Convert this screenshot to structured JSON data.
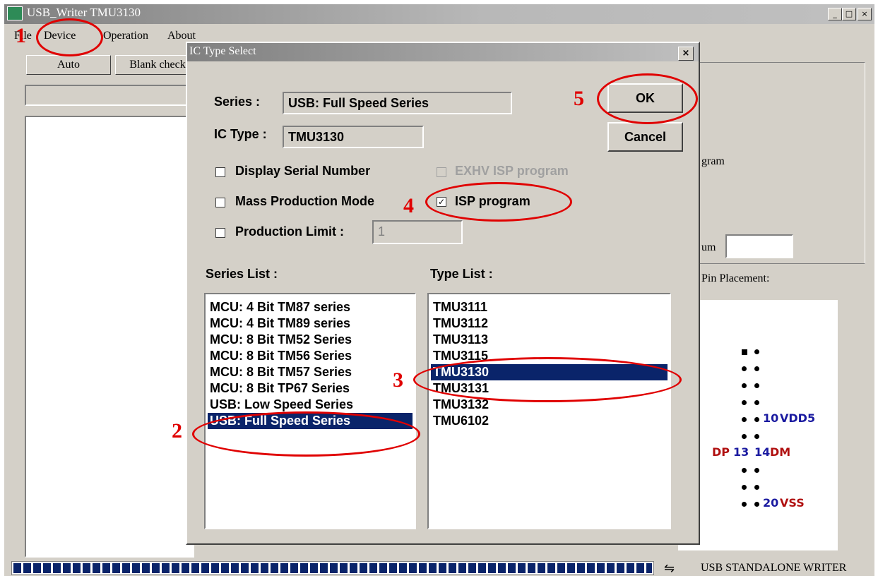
{
  "window": {
    "title": "USB_Writer  TMU3130",
    "minimize_glyph": "_",
    "maximize_glyph": "□",
    "close_glyph": "×"
  },
  "menu": {
    "file": "File",
    "device": "Device",
    "operation": "Operation",
    "about": "About"
  },
  "toolbar": {
    "auto": "Auto",
    "blank_check": "Blank check"
  },
  "background_panel": {
    "program_fragment": "gram",
    "sum_fragment": "um",
    "pin_placement": "Pin Placement:"
  },
  "pin_diagram": {
    "rows": [
      {
        "left": "",
        "left_num": "",
        "right_num": "",
        "right": "",
        "first_square": true
      },
      {
        "left": "",
        "left_num": "",
        "right_num": "",
        "right": ""
      },
      {
        "left": "",
        "left_num": "",
        "right_num": "",
        "right": ""
      },
      {
        "left": "",
        "left_num": "",
        "right_num": "",
        "right": ""
      },
      {
        "left": "",
        "left_num": "",
        "right_num": "10",
        "right": "VDD5"
      },
      {
        "left": "",
        "left_num": "",
        "right_num": "",
        "right": ""
      },
      {
        "left": "DP",
        "left_num": "13",
        "right_num": "14",
        "right": "DM"
      },
      {
        "left": "",
        "left_num": "",
        "right_num": "",
        "right": ""
      },
      {
        "left": "",
        "left_num": "",
        "right_num": "",
        "right": ""
      },
      {
        "left": "",
        "left_num": "",
        "right_num": "20",
        "right": "VSS"
      }
    ],
    "colors": {
      "pin_number": "#1a1aa0",
      "label_red": "#b01010",
      "label_blue": "#1a1aa0"
    }
  },
  "statusbar": {
    "progress_fraction": 1.0,
    "icon": "usb-icon",
    "text": "USB STANDALONE WRITER"
  },
  "dialog": {
    "title": "IC Type Select",
    "close_glyph": "×",
    "series_label": "Series :",
    "series_value": "USB: Full Speed Series",
    "ic_type_label": "IC Type :",
    "ic_type_value": "TMU3130",
    "ok": "OK",
    "cancel": "Cancel",
    "options": {
      "display_serial": {
        "label": "Display Serial Number",
        "checked": false
      },
      "mass_production": {
        "label": "Mass Production Mode",
        "checked": false
      },
      "production_limit": {
        "label": "Production Limit :",
        "checked": false,
        "value": "1"
      },
      "exhv_isp": {
        "label": "EXHV ISP program",
        "checked": false,
        "disabled": true
      },
      "isp_program": {
        "label": "ISP program",
        "checked": true
      }
    },
    "series_list_label": "Series List :",
    "type_list_label": "Type List :",
    "series_list": [
      "MCU: 4 Bit TM87 series",
      "MCU: 4 Bit TM89 series",
      "MCU: 8 Bit TM52 Series",
      "MCU: 8 Bit TM56 Series",
      "MCU: 8 Bit TM57 Series",
      "MCU: 8 Bit TP67 Series",
      "USB: Low Speed Series",
      "USB: Full Speed Series"
    ],
    "series_selected_index": 7,
    "type_list": [
      "TMU3111",
      "TMU3112",
      "TMU3113",
      "TMU3115",
      "TMU3130",
      "TMU3131",
      "TMU3132",
      "TMU6102"
    ],
    "type_selected_index": 4
  },
  "annotations": {
    "step1": "1",
    "step2": "2",
    "step3": "3",
    "step4": "4",
    "step5": "5",
    "color": "#e00000"
  }
}
